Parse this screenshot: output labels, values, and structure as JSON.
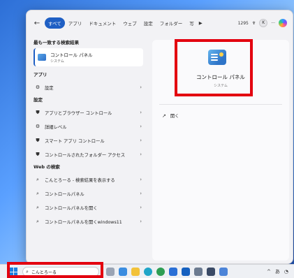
{
  "tabs": [
    "すべて",
    "アプリ",
    "ドキュメント",
    "ウェブ",
    "設定",
    "フォルダー",
    "写"
  ],
  "topbar": {
    "back_glyph": "←",
    "more_tabs_glyph": "▶",
    "points": "1295",
    "avatar_letter": "K",
    "menu_glyph": "···"
  },
  "left": {
    "best_match_title": "最も一致する検索結果",
    "best_match": {
      "title": "コントロール パネル",
      "subtitle": "システム"
    },
    "apps_title": "アプリ",
    "apps": [
      {
        "label": "設定",
        "icon": "gear-icon"
      }
    ],
    "settings_title": "設定",
    "settings": [
      {
        "label": "アプリとブラウザー コントロール",
        "icon": "shield-icon"
      },
      {
        "label": "詳細レベル",
        "icon": "gear-icon"
      },
      {
        "label": "スマート アプリ コントロール",
        "icon": "shield-icon"
      },
      {
        "label": "コントロールされたフォルダー アクセス",
        "icon": "shield-icon"
      }
    ],
    "web_title": "Web の検索",
    "web": [
      {
        "label": "こんとろーる - 検索結果を表示する"
      },
      {
        "label": "コントロールパネル"
      },
      {
        "label": "コントロールパネルを開く"
      },
      {
        "label": "コントロールパネルを開くwindows11"
      }
    ]
  },
  "right": {
    "title": "コントロール パネル",
    "subtitle": "システム",
    "open_label": "開く"
  },
  "taskbar": {
    "search_value": "こんとろーる",
    "tray_up": "^",
    "tray_ime": "あ"
  },
  "colors": {
    "accent": "#1f5fc4",
    "highlight_red": "#e3000f"
  }
}
